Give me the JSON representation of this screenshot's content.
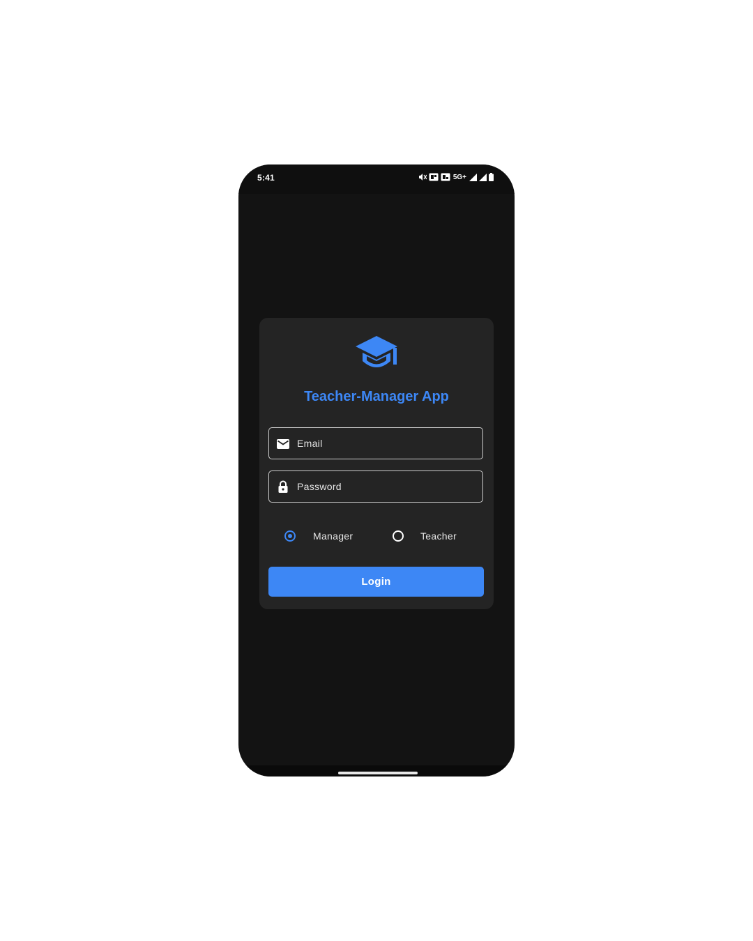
{
  "status_bar": {
    "time": "5:41",
    "network": "5G+",
    "icons": [
      "mute-icon",
      "sim-icon",
      "sim-icon",
      "signal-icon",
      "signal-icon",
      "battery-icon"
    ]
  },
  "login_card": {
    "logo_icon": "graduation-cap-icon",
    "title": "Teacher-Manager App",
    "email": {
      "icon": "mail-icon",
      "placeholder": "Email",
      "value": ""
    },
    "password": {
      "icon": "lock-icon",
      "placeholder": "Password",
      "value": ""
    },
    "roles": {
      "options": [
        "Manager",
        "Teacher"
      ],
      "selected": "Manager"
    },
    "login_label": "Login"
  },
  "colors": {
    "accent": "#3d87f5",
    "background": "#131313",
    "card": "#242424"
  }
}
